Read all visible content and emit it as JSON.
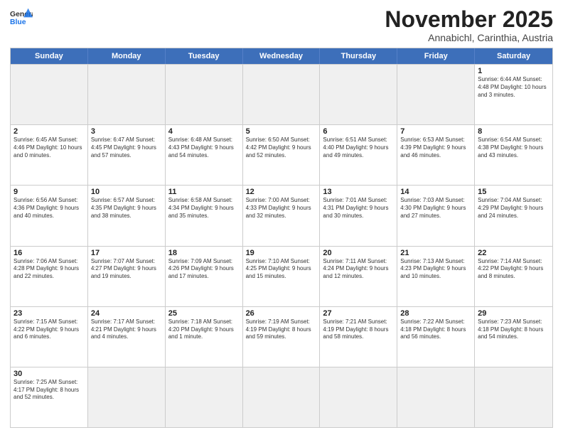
{
  "header": {
    "logo_general": "General",
    "logo_blue": "Blue",
    "month_title": "November 2025",
    "subtitle": "Annabichl, Carinthia, Austria"
  },
  "weekdays": [
    "Sunday",
    "Monday",
    "Tuesday",
    "Wednesday",
    "Thursday",
    "Friday",
    "Saturday"
  ],
  "rows": [
    [
      {
        "day": "",
        "info": "",
        "empty": true
      },
      {
        "day": "",
        "info": "",
        "empty": true
      },
      {
        "day": "",
        "info": "",
        "empty": true
      },
      {
        "day": "",
        "info": "",
        "empty": true
      },
      {
        "day": "",
        "info": "",
        "empty": true
      },
      {
        "day": "",
        "info": "",
        "empty": true
      },
      {
        "day": "1",
        "info": "Sunrise: 6:44 AM\nSunset: 4:48 PM\nDaylight: 10 hours and 3 minutes."
      }
    ],
    [
      {
        "day": "2",
        "info": "Sunrise: 6:45 AM\nSunset: 4:46 PM\nDaylight: 10 hours and 0 minutes."
      },
      {
        "day": "3",
        "info": "Sunrise: 6:47 AM\nSunset: 4:45 PM\nDaylight: 9 hours and 57 minutes."
      },
      {
        "day": "4",
        "info": "Sunrise: 6:48 AM\nSunset: 4:43 PM\nDaylight: 9 hours and 54 minutes."
      },
      {
        "day": "5",
        "info": "Sunrise: 6:50 AM\nSunset: 4:42 PM\nDaylight: 9 hours and 52 minutes."
      },
      {
        "day": "6",
        "info": "Sunrise: 6:51 AM\nSunset: 4:40 PM\nDaylight: 9 hours and 49 minutes."
      },
      {
        "day": "7",
        "info": "Sunrise: 6:53 AM\nSunset: 4:39 PM\nDaylight: 9 hours and 46 minutes."
      },
      {
        "day": "8",
        "info": "Sunrise: 6:54 AM\nSunset: 4:38 PM\nDaylight: 9 hours and 43 minutes."
      }
    ],
    [
      {
        "day": "9",
        "info": "Sunrise: 6:56 AM\nSunset: 4:36 PM\nDaylight: 9 hours and 40 minutes."
      },
      {
        "day": "10",
        "info": "Sunrise: 6:57 AM\nSunset: 4:35 PM\nDaylight: 9 hours and 38 minutes."
      },
      {
        "day": "11",
        "info": "Sunrise: 6:58 AM\nSunset: 4:34 PM\nDaylight: 9 hours and 35 minutes."
      },
      {
        "day": "12",
        "info": "Sunrise: 7:00 AM\nSunset: 4:33 PM\nDaylight: 9 hours and 32 minutes."
      },
      {
        "day": "13",
        "info": "Sunrise: 7:01 AM\nSunset: 4:31 PM\nDaylight: 9 hours and 30 minutes."
      },
      {
        "day": "14",
        "info": "Sunrise: 7:03 AM\nSunset: 4:30 PM\nDaylight: 9 hours and 27 minutes."
      },
      {
        "day": "15",
        "info": "Sunrise: 7:04 AM\nSunset: 4:29 PM\nDaylight: 9 hours and 24 minutes."
      }
    ],
    [
      {
        "day": "16",
        "info": "Sunrise: 7:06 AM\nSunset: 4:28 PM\nDaylight: 9 hours and 22 minutes."
      },
      {
        "day": "17",
        "info": "Sunrise: 7:07 AM\nSunset: 4:27 PM\nDaylight: 9 hours and 19 minutes."
      },
      {
        "day": "18",
        "info": "Sunrise: 7:09 AM\nSunset: 4:26 PM\nDaylight: 9 hours and 17 minutes."
      },
      {
        "day": "19",
        "info": "Sunrise: 7:10 AM\nSunset: 4:25 PM\nDaylight: 9 hours and 15 minutes."
      },
      {
        "day": "20",
        "info": "Sunrise: 7:11 AM\nSunset: 4:24 PM\nDaylight: 9 hours and 12 minutes."
      },
      {
        "day": "21",
        "info": "Sunrise: 7:13 AM\nSunset: 4:23 PM\nDaylight: 9 hours and 10 minutes."
      },
      {
        "day": "22",
        "info": "Sunrise: 7:14 AM\nSunset: 4:22 PM\nDaylight: 9 hours and 8 minutes."
      }
    ],
    [
      {
        "day": "23",
        "info": "Sunrise: 7:15 AM\nSunset: 4:22 PM\nDaylight: 9 hours and 6 minutes."
      },
      {
        "day": "24",
        "info": "Sunrise: 7:17 AM\nSunset: 4:21 PM\nDaylight: 9 hours and 4 minutes."
      },
      {
        "day": "25",
        "info": "Sunrise: 7:18 AM\nSunset: 4:20 PM\nDaylight: 9 hours and 1 minute."
      },
      {
        "day": "26",
        "info": "Sunrise: 7:19 AM\nSunset: 4:19 PM\nDaylight: 8 hours and 59 minutes."
      },
      {
        "day": "27",
        "info": "Sunrise: 7:21 AM\nSunset: 4:19 PM\nDaylight: 8 hours and 58 minutes."
      },
      {
        "day": "28",
        "info": "Sunrise: 7:22 AM\nSunset: 4:18 PM\nDaylight: 8 hours and 56 minutes."
      },
      {
        "day": "29",
        "info": "Sunrise: 7:23 AM\nSunset: 4:18 PM\nDaylight: 8 hours and 54 minutes."
      }
    ],
    [
      {
        "day": "30",
        "info": "Sunrise: 7:25 AM\nSunset: 4:17 PM\nDaylight: 8 hours and 52 minutes."
      },
      {
        "day": "",
        "info": "",
        "empty": true
      },
      {
        "day": "",
        "info": "",
        "empty": true
      },
      {
        "day": "",
        "info": "",
        "empty": true
      },
      {
        "day": "",
        "info": "",
        "empty": true
      },
      {
        "day": "",
        "info": "",
        "empty": true
      },
      {
        "day": "",
        "info": "",
        "empty": true
      }
    ]
  ]
}
